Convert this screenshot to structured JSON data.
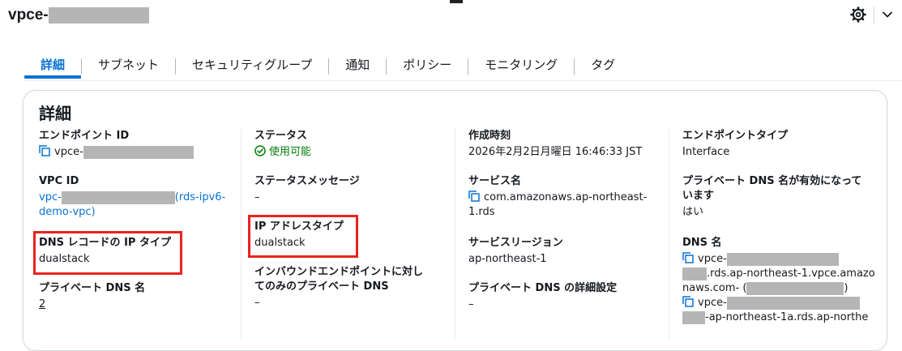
{
  "header": {
    "title_prefix": "vpce-",
    "settings_icon": "gear-icon",
    "expand_icon": "chevron-down-icon"
  },
  "tabs": [
    {
      "label": "詳細",
      "active": true
    },
    {
      "label": "サブネット"
    },
    {
      "label": "セキュリティグループ"
    },
    {
      "label": "通知"
    },
    {
      "label": "ポリシー"
    },
    {
      "label": "モニタリング"
    },
    {
      "label": "タグ"
    }
  ],
  "panel": {
    "title": "詳細",
    "col1": {
      "endpoint_id_label": "エンドポイント ID",
      "endpoint_id_value": "vpce-",
      "vpc_id_label": "VPC ID",
      "vpc_id_value_prefix": "vpc-",
      "vpc_id_name_line1": "(rds-ipv6-",
      "vpc_id_name_line2": "demo-vpc)",
      "dns_record_ip_type_label": "DNS レコードの IP タイプ",
      "dns_record_ip_type_value": "dualstack",
      "private_dns_name_label": "プライベート DNS 名",
      "private_dns_name_value": "2"
    },
    "col2": {
      "status_label": "ステータス",
      "status_value": "使用可能",
      "status_message_label": "ステータスメッセージ",
      "status_message_value": "–",
      "ip_address_type_label": "IP アドレスタイプ",
      "ip_address_type_value": "dualstack",
      "inbound_private_dns_label_line1": "インバウンドエンドポイントに対し",
      "inbound_private_dns_label_line2": "てのみのプライベート DNS",
      "inbound_private_dns_value": "–"
    },
    "col3": {
      "created_label": "作成時刻",
      "created_value": "2026年2月2日月曜日 16:46:33 JST",
      "service_name_label": "サービス名",
      "service_name_line1": "com.amazonaws.ap-northeast-",
      "service_name_line2": "1.rds",
      "service_region_label": "サービスリージョン",
      "service_region_value": "ap-northeast-1",
      "private_dns_detail_label": "プライベート DNS の詳細設定",
      "private_dns_detail_value": "–"
    },
    "col4": {
      "endpoint_type_label": "エンドポイントタイプ",
      "endpoint_type_value": "Interface",
      "private_dns_enabled_label_line1": "プライベート DNS 名が有効になって",
      "private_dns_enabled_label_line2": "います",
      "private_dns_enabled_value": "はい",
      "dns_names_label": "DNS 名",
      "dns1_prefix": "vpce-",
      "dns1_line2": ".rds.ap-northeast-1.vpce.amazo",
      "dns1_line3_a": "naws.com- (",
      "dns1_line3_b": ")",
      "dns2_prefix": "vpce-",
      "dns2_line2": "-ap-northeast-1a.rds.ap-northe"
    }
  },
  "colors": {
    "accent": "#0972d3",
    "status_ok": "#037f0c",
    "highlight": "#e8231e",
    "redaction": "#b5b5b5"
  }
}
